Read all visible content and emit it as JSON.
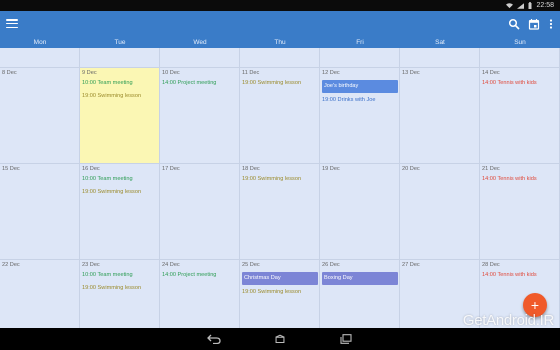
{
  "status": {
    "time": "22:58"
  },
  "days": [
    "Mon",
    "Tue",
    "Wed",
    "Thu",
    "Fri",
    "Sat",
    "Sun"
  ],
  "weeks": [
    {
      "cells": [
        {
          "date": "8 Dec",
          "events": []
        },
        {
          "date": "9 Dec",
          "today": true,
          "events": [
            {
              "text": "10:00 Team meeting",
              "color": "green"
            },
            {
              "text": "19:00 Swimming lesson",
              "color": "olive"
            }
          ]
        },
        {
          "date": "10 Dec",
          "events": [
            {
              "text": "14:00 Project meeting",
              "color": "green"
            }
          ]
        },
        {
          "date": "11 Dec",
          "events": [
            {
              "text": "19:00 Swimming lesson",
              "color": "olive"
            }
          ]
        },
        {
          "date": "12 Dec",
          "events": [
            {
              "chip": "Joe's birthday",
              "color": "blue"
            },
            {
              "text": "19:00 Drinks with Joe",
              "color": "blue"
            }
          ]
        },
        {
          "date": "13 Dec",
          "events": []
        },
        {
          "date": "14 Dec",
          "events": [
            {
              "text": "14:00 Tennis with kids",
              "color": "red"
            }
          ]
        }
      ]
    },
    {
      "cells": [
        {
          "date": "15 Dec",
          "events": []
        },
        {
          "date": "16 Dec",
          "events": [
            {
              "text": "10:00 Team meeting",
              "color": "green"
            },
            {
              "text": "19:00 Swimming lesson",
              "color": "olive"
            }
          ]
        },
        {
          "date": "17 Dec",
          "events": []
        },
        {
          "date": "18 Dec",
          "events": [
            {
              "text": "19:00 Swimming lesson",
              "color": "olive"
            }
          ]
        },
        {
          "date": "19 Dec",
          "events": []
        },
        {
          "date": "20 Dec",
          "events": []
        },
        {
          "date": "21 Dec",
          "events": [
            {
              "text": "14:00 Tennis with kids",
              "color": "red"
            }
          ]
        }
      ]
    },
    {
      "cells": [
        {
          "date": "22 Dec",
          "events": []
        },
        {
          "date": "23 Dec",
          "events": [
            {
              "text": "10:00 Team meeting",
              "color": "green"
            },
            {
              "text": "19:00 Swimming lesson",
              "color": "olive"
            }
          ]
        },
        {
          "date": "24 Dec",
          "events": [
            {
              "text": "14:00 Project meeting",
              "color": "green"
            }
          ]
        },
        {
          "date": "25 Dec",
          "events": [
            {
              "chip": "Christmas Day",
              "color": "purple"
            },
            {
              "text": "19:00 Swimming lesson",
              "color": "olive"
            }
          ]
        },
        {
          "date": "26 Dec",
          "events": [
            {
              "chip": "Boxing Day",
              "color": "purple"
            }
          ]
        },
        {
          "date": "27 Dec",
          "events": []
        },
        {
          "date": "28 Dec",
          "events": [
            {
              "text": "14:00 Tennis with kids",
              "color": "red"
            }
          ]
        }
      ]
    }
  ],
  "fab": {
    "label": "+"
  },
  "watermark": "GetAndroid.IR",
  "colors": {
    "appbar": "#3a7cc8",
    "grid": "#dde6f7",
    "today": "#fbf7b4",
    "fab": "#f05a2a"
  },
  "icons": {
    "menu": "menu-icon",
    "search": "search-icon",
    "today": "calendar-today-icon",
    "overflow": "more-vert-icon",
    "back": "back-icon",
    "home": "home-icon",
    "recents": "recents-icon"
  }
}
